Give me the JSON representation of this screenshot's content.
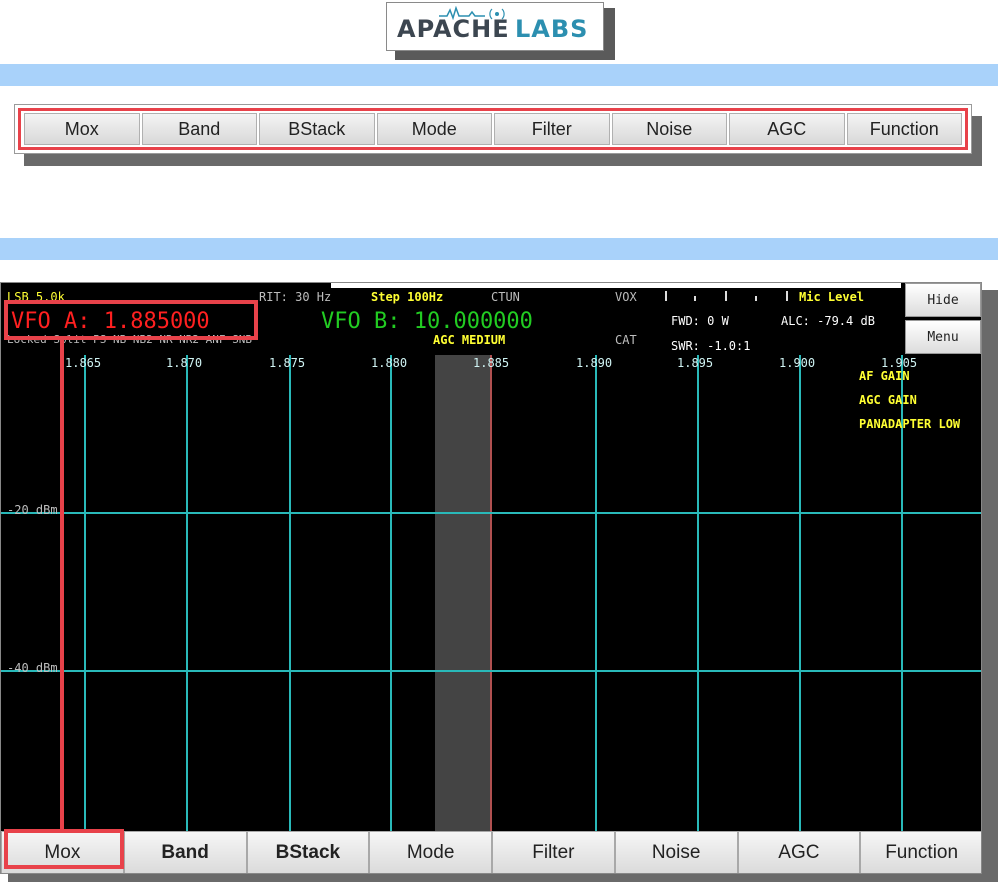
{
  "logo": {
    "brand_left": "APACHE",
    "brand_right": "LABS"
  },
  "top_toolbar": {
    "buttons": [
      "Mox",
      "Band",
      "BStack",
      "Mode",
      "Filter",
      "Noise",
      "AGC",
      "Function"
    ]
  },
  "panadapter": {
    "mode_filter": "LSB 5.0k",
    "rit": "RIT: 30 Hz",
    "step": "Step 100Hz",
    "ctun": "CTUN",
    "vox": "VOX",
    "mic_level": "Mic Level",
    "vfo_a": "VFO A: 1.885000",
    "vfo_b": "VFO B: 10.000000",
    "fwd": "FWD: 0 W",
    "alc": "ALC: -79.4 dB",
    "swr": "SWR: -1.0:1",
    "status_left": "Locked  Split   PS      NB  NB2 NR  NR2 ANF SNB",
    "agc": "AGC MEDIUM",
    "cat": "CAT",
    "hide_button": "Hide",
    "menu_button": "Menu",
    "freq_labels": [
      "1.865",
      "1.870",
      "1.875",
      "1.880",
      "1.885",
      "1.890",
      "1.895",
      "1.900",
      "1.905"
    ],
    "db_labels": [
      "-20 dBm",
      "-40 dBm"
    ],
    "overlay_labels": [
      "AF GAIN",
      "AGC GAIN",
      "PANADAPTER LOW"
    ],
    "bottom_buttons": [
      "Mox",
      "Band",
      "BStack",
      "Mode",
      "Filter",
      "Noise",
      "AGC",
      "Function"
    ]
  },
  "colors": {
    "accent_red": "#e8424a",
    "band_blue": "#a9d2fa",
    "grid_cyan": "#29b9b9",
    "vfo_a_red": "#ff2020",
    "vfo_b_green": "#22cc22",
    "label_yellow": "#ffff33"
  }
}
